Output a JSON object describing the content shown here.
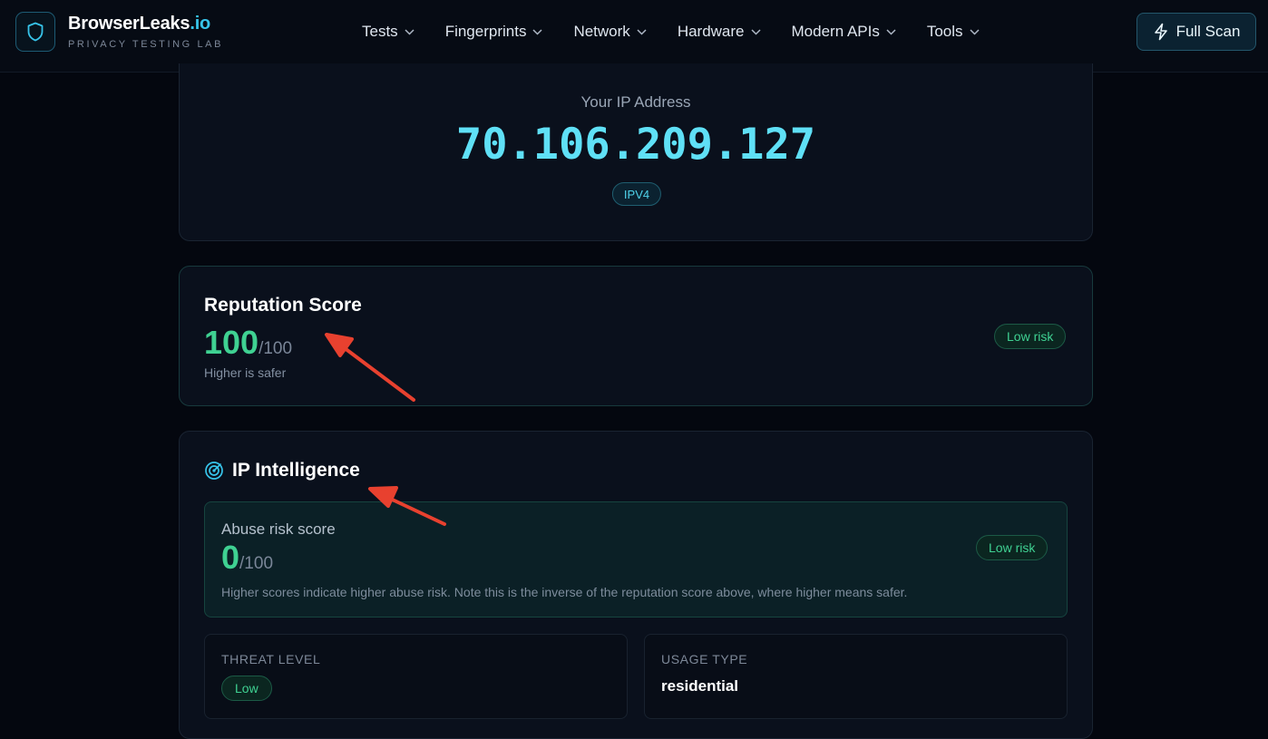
{
  "header": {
    "brand_name": "BrowserLeaks",
    "brand_tld": ".io",
    "brand_tagline": "PRIVACY TESTING LAB",
    "nav": [
      {
        "label": "Tests"
      },
      {
        "label": "Fingerprints"
      },
      {
        "label": "Network"
      },
      {
        "label": "Hardware"
      },
      {
        "label": "Modern APIs"
      },
      {
        "label": "Tools"
      }
    ],
    "full_scan_label": "Full Scan"
  },
  "ip": {
    "label": "Your IP Address",
    "value": "70.106.209.127",
    "version_badge": "IPV4"
  },
  "reputation": {
    "title": "Reputation Score",
    "score": "100",
    "max": "/100",
    "note": "Higher is safer",
    "risk_badge": "Low risk"
  },
  "intelligence": {
    "title": "IP Intelligence",
    "abuse": {
      "label": "Abuse risk score",
      "score": "0",
      "max": "/100",
      "note": "Higher scores indicate higher abuse risk. Note this is the inverse of the reputation score above, where higher means safer.",
      "risk_badge": "Low risk"
    },
    "threat_level": {
      "label": "THREAT LEVEL",
      "value": "Low"
    },
    "usage_type": {
      "label": "USAGE TYPE",
      "value": "residential"
    }
  },
  "colors": {
    "accent_cyan": "#5fe0f6",
    "success_green": "#3fd192",
    "annotation_red": "#e8412f"
  }
}
